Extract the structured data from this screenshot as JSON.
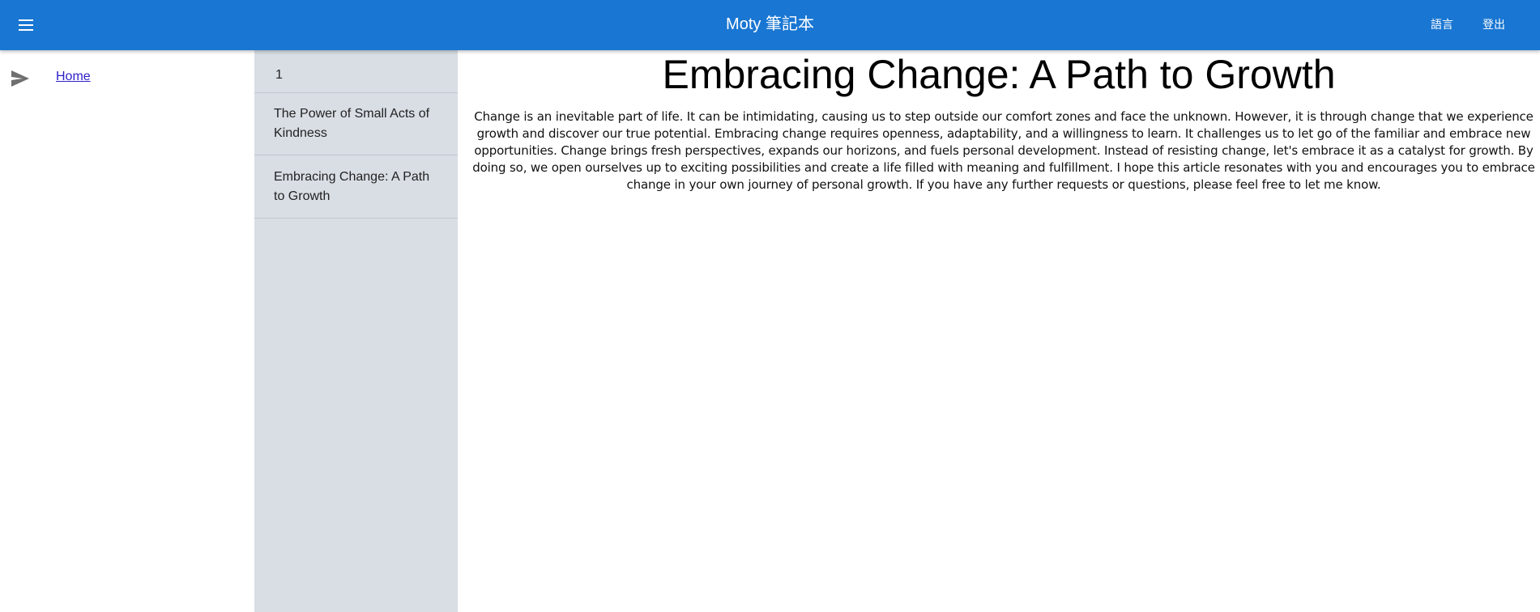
{
  "header": {
    "title": "Moty 筆記本",
    "menu_icon": "menu-icon",
    "language_label": "語言",
    "logout_label": "登出",
    "background_color": "#1976d2"
  },
  "sidebar": {
    "items": [
      {
        "icon": "send-icon",
        "label": "Home"
      }
    ]
  },
  "notes": {
    "items": [
      {
        "title": "1"
      },
      {
        "title": "The Power of Small Acts of Kindness"
      },
      {
        "title": "Embracing Change: A Path to Growth"
      }
    ],
    "background_color": "#d9dee5"
  },
  "article": {
    "title": "Embracing Change: A Path to Growth",
    "body": "Change is an inevitable part of life. It can be intimidating, causing us to step outside our comfort zones and face the unknown. However, it is through change that we experience growth and discover our true potential. Embracing change requires openness, adaptability, and a willingness to learn. It challenges us to let go of the familiar and embrace new opportunities. Change brings fresh perspectives, expands our horizons, and fuels personal development. Instead of resisting change, let's embrace it as a catalyst for growth. By doing so, we open ourselves up to exciting possibilities and create a life filled with meaning and fulfillment. I hope this article resonates with you and encourages you to embrace change in your own journey of personal growth. If you have any further requests or questions, please feel free to let me know."
  }
}
